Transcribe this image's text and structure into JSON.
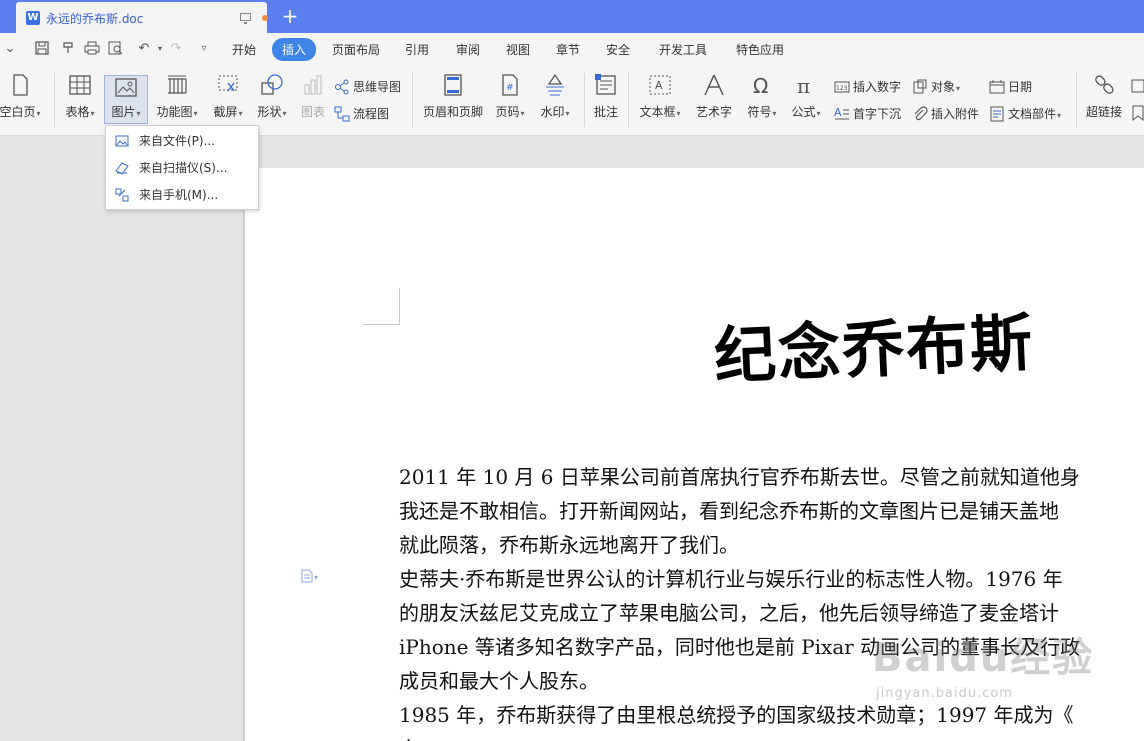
{
  "window": {
    "tab_title": "永远的乔布斯.doc",
    "tab_icon": "W",
    "new_tab": "+"
  },
  "menubar": {
    "items": [
      "开始",
      "插入",
      "页面布局",
      "引用",
      "审阅",
      "视图",
      "章节",
      "安全",
      "开发工具",
      "特色应用"
    ],
    "active": "插入",
    "accent": "#3f84e8"
  },
  "ribbon": {
    "blank_page": "空白页",
    "table": "表格",
    "picture": "图片",
    "function_chart": "功能图",
    "screenshot": "截屏",
    "shape": "形状",
    "chart": "图表",
    "mindmap": "思维导图",
    "flowchart": "流程图",
    "header_footer": "页眉和页脚",
    "page_number": "页码",
    "watermark": "水印",
    "comment": "批注",
    "textbox": "文本框",
    "wordart": "艺术字",
    "symbol": "符号",
    "formula": "公式",
    "insert_number": "插入数字",
    "object": "对象",
    "date": "日期",
    "drop_cap": "首字下沉",
    "attachment": "插入附件",
    "doc_parts": "文档部件",
    "hyperlink": "超链接"
  },
  "picture_menu": {
    "items": [
      "来自文件(P)...",
      "来自扫描仪(S)...",
      "来自手机(M)..."
    ]
  },
  "document": {
    "title": "纪念乔布斯",
    "lines": [
      "2011 年 10 月 6 日苹果公司前首席执行官乔布斯去世。尽管之前就知道他身",
      "我还是不敢相信。打开新闻网站，看到纪念乔布斯的文章图片已是铺天盖地",
      "就此陨落，乔布斯永远地离开了我们。",
      "史蒂夫·乔布斯是世界公认的计算机行业与娱乐行业的标志性人物。1976 年",
      "的朋友沃兹尼艾克成立了苹果电脑公司，之后，他先后领导缔造了麦金塔计",
      "iPhone 等诸多知名数字产品，同时他也是前 Pixar 动画公司的董事长及行政",
      "成员和最大个人股东。",
      "1985 年，乔布斯获得了由里根总统授予的国家级技术勋章；1997 年成为《",
      "白"
    ]
  },
  "watermark": {
    "main": "Baidu经验",
    "sub": "jingyan.baidu.com"
  }
}
